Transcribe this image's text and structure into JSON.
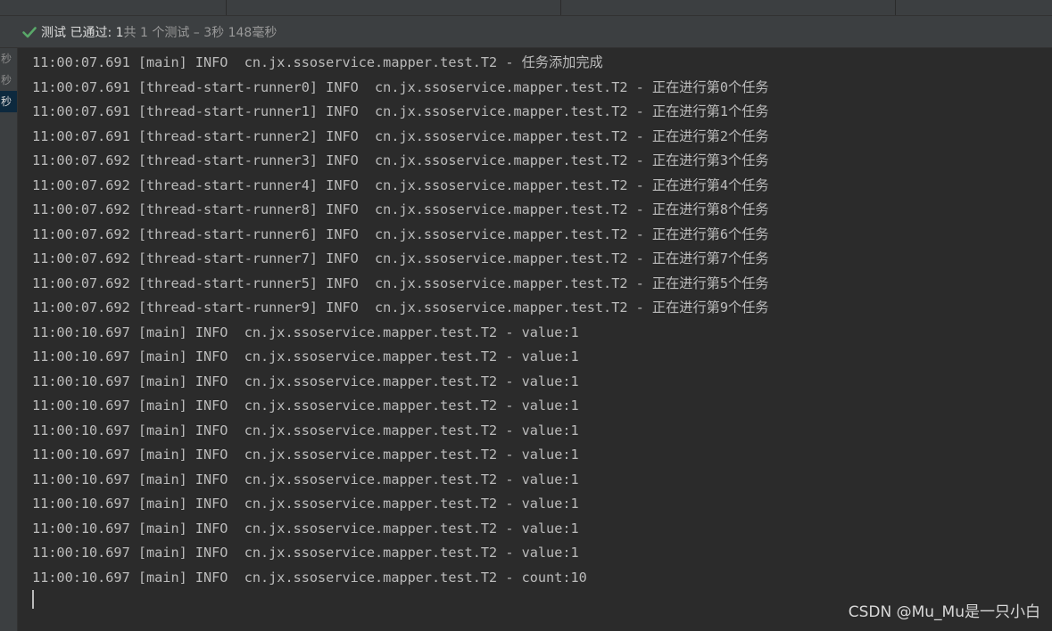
{
  "status": {
    "icon": "check-icon",
    "strong_text": "测试 已通过: 1",
    "muted_text": "共 1 个测试 – 3秒 148毫秒"
  },
  "left_panel": {
    "items": [
      {
        "label": "秒",
        "selected": false
      },
      {
        "label": "秒",
        "selected": false
      },
      {
        "label": "秒",
        "selected": true
      }
    ]
  },
  "console": {
    "lines": [
      "11:00:07.691 [main] INFO  cn.jx.ssoservice.mapper.test.T2 - 任务添加完成",
      "11:00:07.691 [thread-start-runner0] INFO  cn.jx.ssoservice.mapper.test.T2 - 正在进行第0个任务",
      "11:00:07.691 [thread-start-runner1] INFO  cn.jx.ssoservice.mapper.test.T2 - 正在进行第1个任务",
      "11:00:07.691 [thread-start-runner2] INFO  cn.jx.ssoservice.mapper.test.T2 - 正在进行第2个任务",
      "11:00:07.692 [thread-start-runner3] INFO  cn.jx.ssoservice.mapper.test.T2 - 正在进行第3个任务",
      "11:00:07.692 [thread-start-runner4] INFO  cn.jx.ssoservice.mapper.test.T2 - 正在进行第4个任务",
      "11:00:07.692 [thread-start-runner8] INFO  cn.jx.ssoservice.mapper.test.T2 - 正在进行第8个任务",
      "11:00:07.692 [thread-start-runner6] INFO  cn.jx.ssoservice.mapper.test.T2 - 正在进行第6个任务",
      "11:00:07.692 [thread-start-runner7] INFO  cn.jx.ssoservice.mapper.test.T2 - 正在进行第7个任务",
      "11:00:07.692 [thread-start-runner5] INFO  cn.jx.ssoservice.mapper.test.T2 - 正在进行第5个任务",
      "11:00:07.692 [thread-start-runner9] INFO  cn.jx.ssoservice.mapper.test.T2 - 正在进行第9个任务",
      "11:00:10.697 [main] INFO  cn.jx.ssoservice.mapper.test.T2 - value:1",
      "11:00:10.697 [main] INFO  cn.jx.ssoservice.mapper.test.T2 - value:1",
      "11:00:10.697 [main] INFO  cn.jx.ssoservice.mapper.test.T2 - value:1",
      "11:00:10.697 [main] INFO  cn.jx.ssoservice.mapper.test.T2 - value:1",
      "11:00:10.697 [main] INFO  cn.jx.ssoservice.mapper.test.T2 - value:1",
      "11:00:10.697 [main] INFO  cn.jx.ssoservice.mapper.test.T2 - value:1",
      "11:00:10.697 [main] INFO  cn.jx.ssoservice.mapper.test.T2 - value:1",
      "11:00:10.697 [main] INFO  cn.jx.ssoservice.mapper.test.T2 - value:1",
      "11:00:10.697 [main] INFO  cn.jx.ssoservice.mapper.test.T2 - value:1",
      "11:00:10.697 [main] INFO  cn.jx.ssoservice.mapper.test.T2 - value:1",
      "11:00:10.697 [main] INFO  cn.jx.ssoservice.mapper.test.T2 - count:10"
    ]
  },
  "watermark": "CSDN @Mu_Mu是一只小白",
  "colors": {
    "pass_green": "#59a869",
    "console_bg": "#2b2b2b",
    "console_text": "#bbbbbb",
    "toolbar_bg": "#3c3f41",
    "selection_bg": "#0d293e"
  }
}
